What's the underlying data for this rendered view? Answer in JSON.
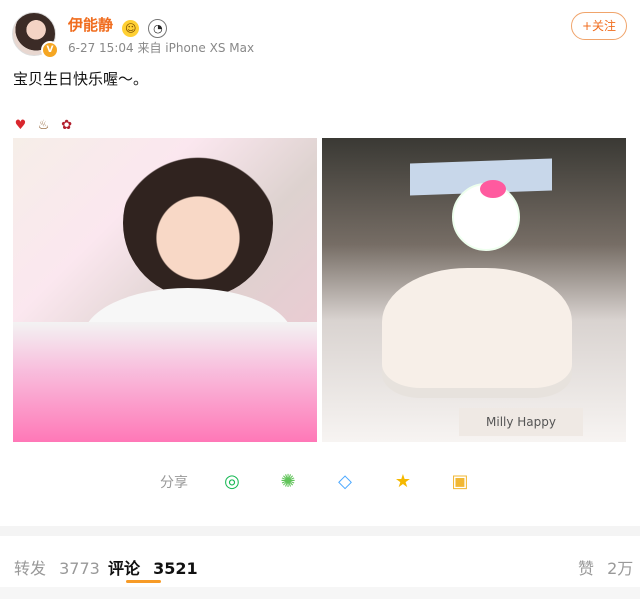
{
  "post": {
    "username": "伊能静",
    "timestamp": "6-27 15:04",
    "source": "来自 iPhone XS Max",
    "follow_label": "+关注",
    "text": "宝贝生日快乐喔～。",
    "reaction_icons": [
      "heart-icon",
      "cake-icon",
      "rose-icon"
    ],
    "images": [
      {
        "label": "Birthday girl photo"
      },
      {
        "label": "Hello Kitty birthday cake"
      }
    ],
    "cake_board_text": "Milly Happy Birthday"
  },
  "share": {
    "label": "分享",
    "icons": [
      "wechat-icon",
      "moments-icon",
      "qq-icon",
      "favorite-icon",
      "save-image-icon"
    ]
  },
  "stats": {
    "repost_label": "转发",
    "repost_count": "3773",
    "comment_label": "评论",
    "comment_count": "3521",
    "like_label": "赞",
    "like_count": "2万"
  },
  "colors": {
    "accent": "#f06d1f",
    "tab_indicator": "#f79b27",
    "muted": "#999999"
  }
}
